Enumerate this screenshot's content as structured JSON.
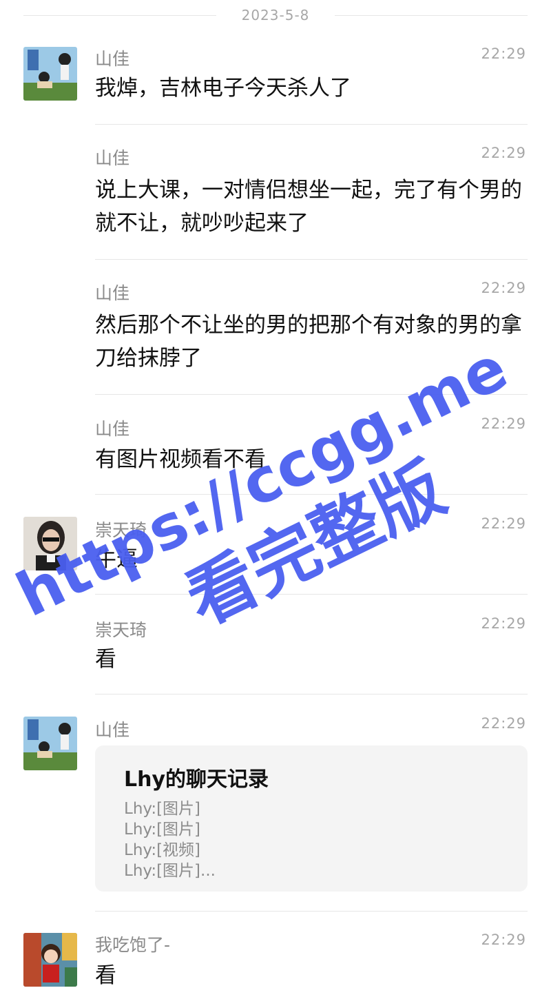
{
  "date": "2023-5-8",
  "messages": [
    {
      "name": "山佳",
      "time": "22:29",
      "text": "我焯，吉林电子今天杀人了"
    },
    {
      "name": "山佳",
      "time": "22:29",
      "text": "说上大课，一对情侣想坐一起，完了有个男的就不让，就吵吵起来了"
    },
    {
      "name": "山佳",
      "time": "22:29",
      "text": "然后那个不让坐的男的把那个有对象的男的拿刀给抹脖了"
    },
    {
      "name": "山佳",
      "time": "22:29",
      "text": "有图片视频看不看"
    },
    {
      "name": "崇天琦",
      "time": "22:29",
      "text": "牛逼"
    },
    {
      "name": "崇天琦",
      "time": "22:29",
      "text": "看"
    },
    {
      "name": "山佳",
      "time": "22:29"
    },
    {
      "name": "我吃饱了-",
      "time": "22:29",
      "text": "看"
    }
  ],
  "card": {
    "title": "Lhy的聊天记录",
    "lines": [
      "Lhy:[图片]",
      "Lhy:[图片]",
      "Lhy:[视频]",
      "Lhy:[图片]..."
    ]
  },
  "watermark": {
    "url": "https://ccgg.me",
    "caption": "看完整版",
    "color": "#4a5ff0"
  },
  "avatar_icons": {
    "shanjia": "cartoon-avatar-icon",
    "chongtianqi": "photo-avatar-icon",
    "wochibaole": "cartoon-girl-avatar-icon"
  }
}
